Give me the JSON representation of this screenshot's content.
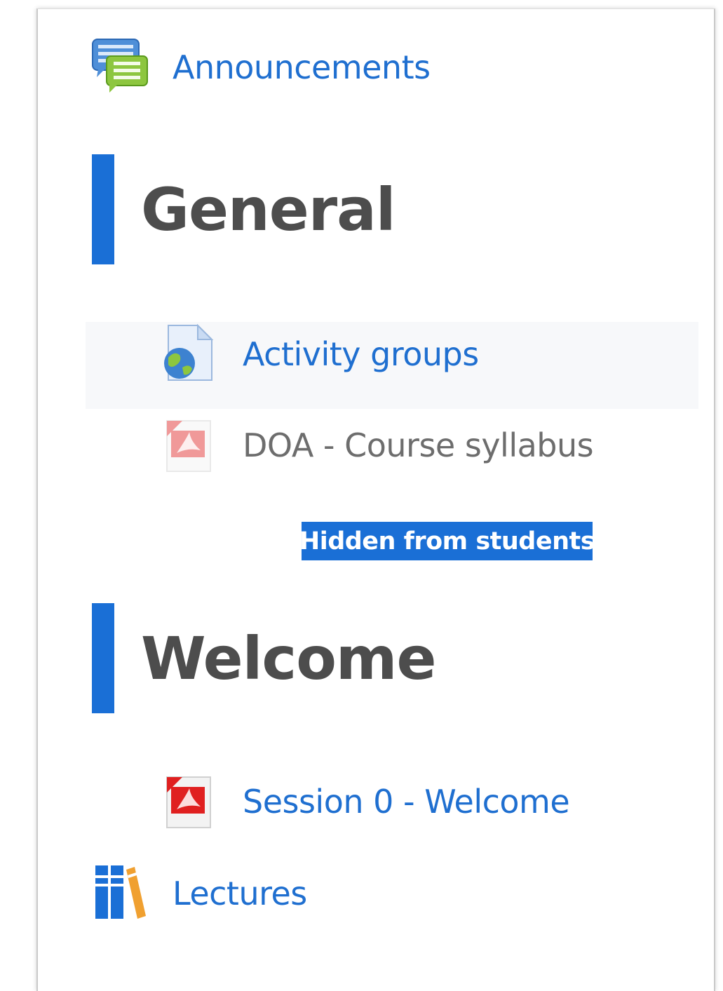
{
  "activities": {
    "announcements": {
      "label": "Announcements",
      "icon": "forum-icon"
    },
    "activity_groups": {
      "label": "Activity groups",
      "icon": "url-globe-icon"
    },
    "course_syllabus": {
      "label": "DOA - Course syllabus",
      "icon": "pdf-icon",
      "badge": "Hidden from students"
    },
    "session0": {
      "label": "Session 0 - Welcome",
      "icon": "pdf-icon"
    },
    "lectures": {
      "label": "Lectures",
      "icon": "book-folder-icon"
    }
  },
  "sections": {
    "general": {
      "title": "General"
    },
    "welcome": {
      "title": "Welcome"
    }
  },
  "colors": {
    "accent": "#1a6fd6",
    "link": "#1f6fd0",
    "dimmed_link": "#6d6d6d",
    "heading": "#4d4d4d"
  }
}
